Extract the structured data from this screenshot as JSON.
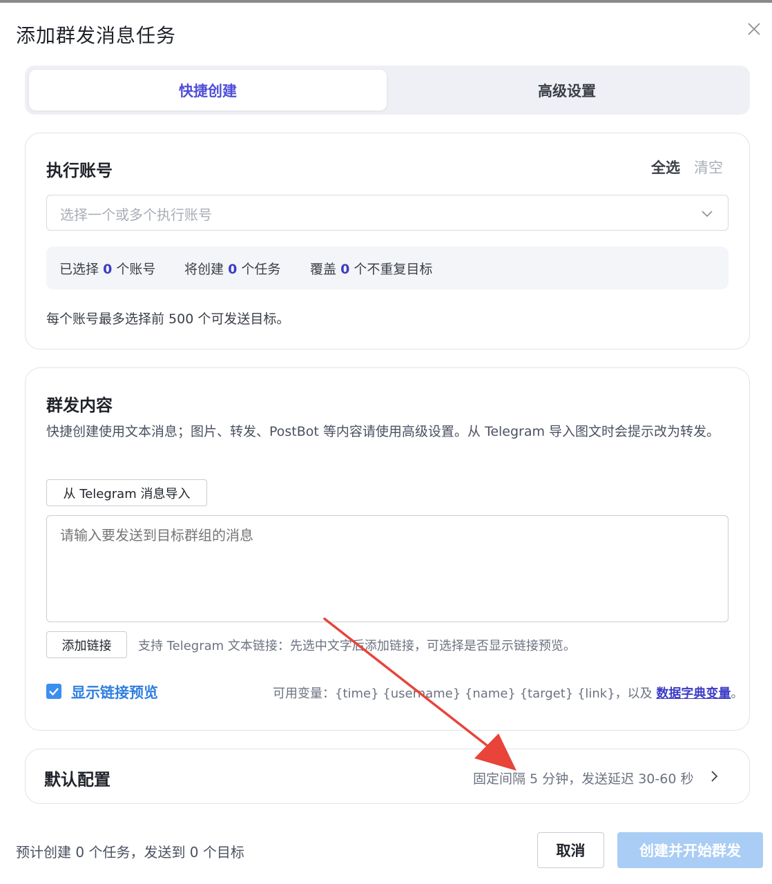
{
  "dialog": {
    "title": "添加群发消息任务",
    "close_icon": "close-icon"
  },
  "tabs": [
    {
      "label": "快捷创建",
      "active": true
    },
    {
      "label": "高级设置",
      "active": false
    }
  ],
  "accounts": {
    "title": "执行账号",
    "select_all": "全选",
    "clear": "清空",
    "select_placeholder": "选择一个或多个执行账号",
    "summary": {
      "selected_prefix": "已选择",
      "selected_count": "0",
      "selected_suffix": "个账号",
      "tasks_prefix": "将创建",
      "tasks_count": "0",
      "tasks_suffix": "个任务",
      "targets_prefix": "覆盖",
      "targets_count": "0",
      "targets_suffix": "个不重复目标"
    },
    "note": "每个账号最多选择前 500 个可发送目标。"
  },
  "content": {
    "title": "群发内容",
    "description": "快捷创建使用文本消息；图片、转发、PostBot 等内容请使用高级设置。从 Telegram 导入图文时会提示改为转发。",
    "import_button": "从 Telegram 消息导入",
    "message_placeholder": "请输入要发送到目标群组的消息",
    "add_link_button": "添加链接",
    "add_link_hint": "支持 Telegram 文本链接：先选中文字后添加链接，可选择是否显示链接预览。",
    "show_preview_label": "显示链接预览",
    "show_preview_checked": true,
    "vars_prefix": "可用变量：{time} {username} {name} {target} {link}，以及",
    "vars_link": "数据字典变量",
    "vars_suffix": "。"
  },
  "default_config": {
    "title": "默认配置",
    "summary": "固定间隔 5 分钟，发送延迟 30-60 秒"
  },
  "footer": {
    "estimate": "预计创建 0 个任务，发送到 0 个目标",
    "cancel": "取消",
    "submit": "创建并开始群发"
  },
  "colors": {
    "accent": "#4d4dd8",
    "primary_disabled": "#a9cdf4",
    "checkbox": "#3a8ff0",
    "annotation_arrow": "#e8443a"
  }
}
